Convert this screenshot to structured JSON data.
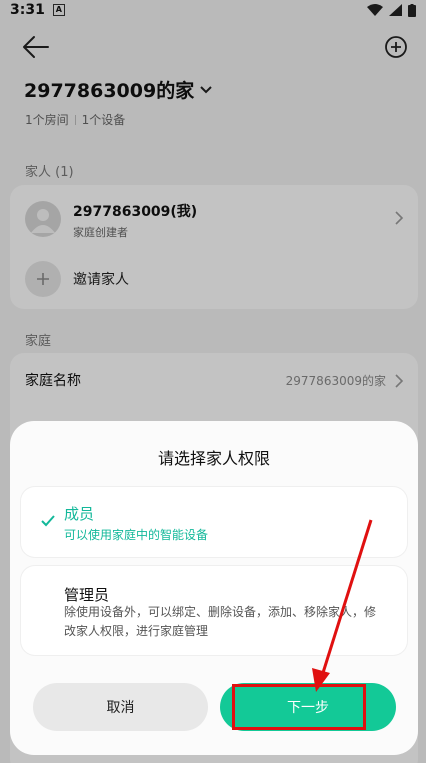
{
  "status_bar": {
    "time": "3:31",
    "notification": "A"
  },
  "home": {
    "title": "2977863009的家",
    "rooms": "1个房间",
    "devices": "1个设备"
  },
  "family_section": {
    "label": "家人 (1)",
    "member": {
      "name": "2977863009(我)",
      "role": "家庭创建者"
    },
    "invite_label": "邀请家人"
  },
  "home_section": {
    "label": "家庭",
    "name_label": "家庭名称",
    "name_value": "2977863009的家"
  },
  "permission_sheet": {
    "title": "请选择家人权限",
    "options": [
      {
        "title": "成员",
        "description": "可以使用家庭中的智能设备",
        "selected": true
      },
      {
        "title": "管理员",
        "description": "除使用设备外，可以绑定、删除设备，添加、移除家人，修改家人权限，进行家庭管理",
        "selected": false
      }
    ],
    "cancel_label": "取消",
    "next_label": "下一步"
  },
  "colors": {
    "accent": "#13c997",
    "annotation": "#e01010"
  }
}
